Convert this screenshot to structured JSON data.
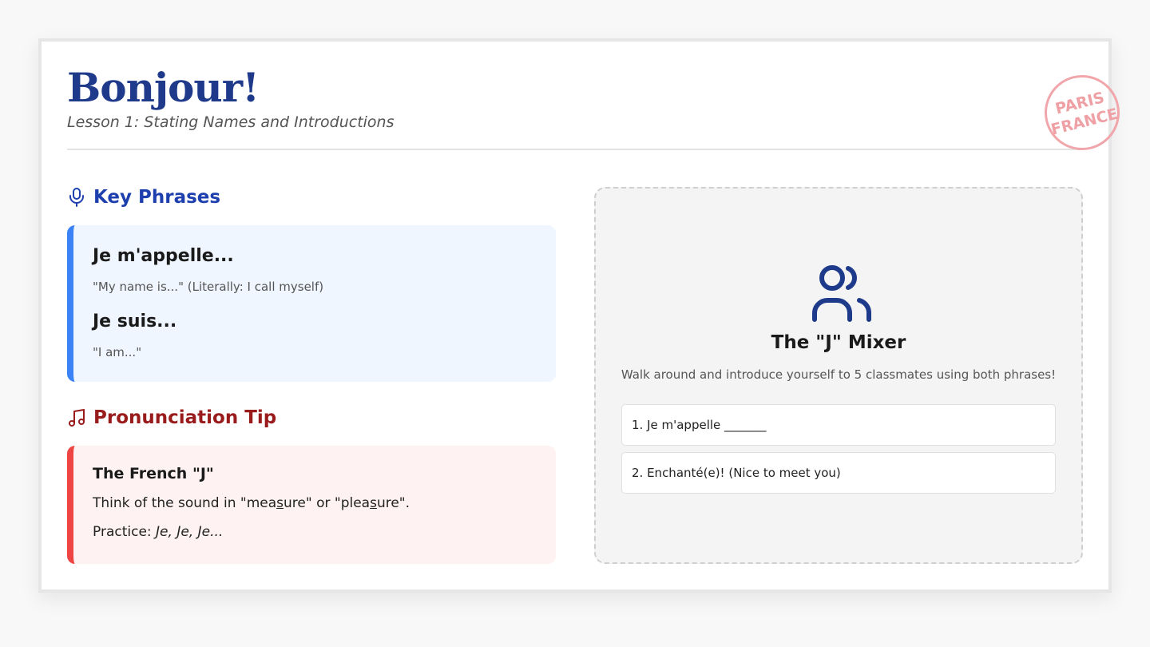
{
  "header": {
    "title": "Bonjour!",
    "subtitle": "Lesson 1: Stating Names and Introductions",
    "stamp_line1": "PARIS",
    "stamp_line2": "FRANCE"
  },
  "key_phrases": {
    "heading": "Key Phrases",
    "icon": "microphone-icon",
    "items": [
      {
        "phrase": "Je m'appelle...",
        "gloss": "\"My name is...\" (Literally: I call myself)"
      },
      {
        "phrase": "Je suis...",
        "gloss": "\"I am...\""
      }
    ]
  },
  "pronunciation": {
    "heading": "Pronunciation Tip",
    "icon": "music-note-icon",
    "tip_title": "The French \"J\"",
    "line1_a": "Think of the sound in \"mea",
    "line1_s1": "s",
    "line1_b": "ure\" or \"plea",
    "line1_s2": "s",
    "line1_c": "ure\".",
    "practice_label": "Practice:",
    "practice_text": "Je, Je, Je..."
  },
  "mixer": {
    "icon": "users-icon",
    "title": "The \"J\" Mixer",
    "description": "Walk around and introduce yourself to 5 classmates using both phrases!",
    "steps": [
      "1. Je m'appelle _______",
      "2. Enchanté(e)! (Nice to meet you)"
    ]
  },
  "colors": {
    "title_blue": "#1f3a8a",
    "accent_blue": "#3b82f6",
    "accent_red": "#ef4444",
    "heading_red": "#991b1b",
    "stamp_pink": "#f0a6ab"
  }
}
